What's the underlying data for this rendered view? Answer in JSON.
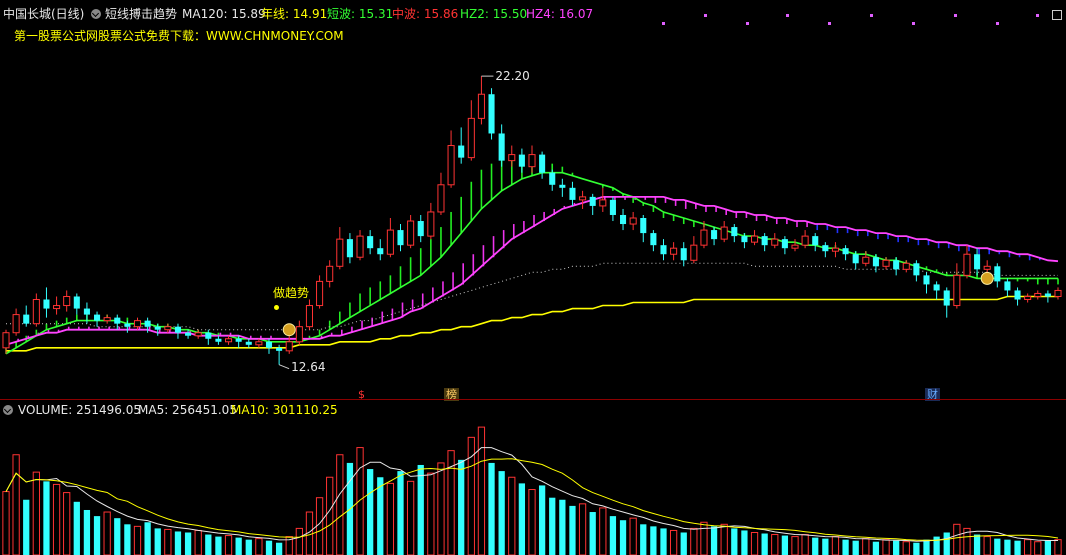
{
  "main_header": {
    "stock_name": "中国长城(日线)",
    "indicator_name": "短线搏击趋势",
    "items": [
      {
        "label": "MA120: 15.89",
        "color": "#e8e8e8"
      },
      {
        "label": "年线: 14.91",
        "color": "#ffff00"
      },
      {
        "label": "短波: 15.31",
        "color": "#33ff33"
      },
      {
        "label": "中波: 15.86",
        "color": "#ff3333"
      },
      {
        "label": "HZ2: 15.50",
        "color": "#33ff33"
      },
      {
        "label": "HZ4: 16.07",
        "color": "#ff44ff"
      }
    ],
    "promo": "第一股票公式网股票公式免费下载：WWW.CHNMONEY.COM"
  },
  "chart_labels": {
    "high": "22.20",
    "low": "12.64",
    "signal": "做趋势",
    "markers": [
      {
        "text": "$",
        "color": "#ff3333"
      },
      {
        "text": "榜",
        "color": "#ffcc66"
      },
      {
        "text": "财",
        "color": "#66aaff"
      }
    ]
  },
  "volume_header": {
    "items": [
      {
        "label": "VOLUME: 251496.05",
        "color": "#e8e8e8"
      },
      {
        "label": "MA5: 256451.05",
        "color": "#e8e8e8"
      },
      {
        "label": "MA10: 301110.25",
        "color": "#ffff00"
      }
    ]
  },
  "chart_data": {
    "type": "candlestick",
    "ylim": [
      12.2,
      22.8
    ],
    "candles": [
      [
        13.2,
        13.7,
        13.0,
        13.8
      ],
      [
        13.7,
        14.3,
        13.6,
        14.5
      ],
      [
        14.3,
        14.0,
        13.9,
        14.6
      ],
      [
        14.0,
        14.8,
        13.9,
        15.0
      ],
      [
        14.8,
        14.5,
        14.2,
        15.2
      ],
      [
        14.5,
        14.6,
        14.3,
        14.9
      ],
      [
        14.6,
        14.9,
        14.4,
        15.1
      ],
      [
        14.9,
        14.5,
        14.3,
        15.0
      ],
      [
        14.5,
        14.3,
        14.0,
        14.7
      ],
      [
        14.3,
        14.1,
        13.9,
        14.4
      ],
      [
        14.1,
        14.2,
        14.0,
        14.3
      ],
      [
        14.2,
        14.0,
        13.8,
        14.3
      ],
      [
        14.0,
        13.9,
        13.7,
        14.1
      ],
      [
        13.9,
        14.1,
        13.8,
        14.2
      ],
      [
        14.1,
        13.9,
        13.7,
        14.2
      ],
      [
        13.9,
        13.8,
        13.6,
        14.0
      ],
      [
        13.8,
        13.9,
        13.7,
        14.0
      ],
      [
        13.9,
        13.7,
        13.5,
        14.0
      ],
      [
        13.7,
        13.6,
        13.5,
        13.8
      ],
      [
        13.6,
        13.7,
        13.5,
        13.8
      ],
      [
        13.7,
        13.5,
        13.3,
        13.8
      ],
      [
        13.5,
        13.4,
        13.3,
        13.6
      ],
      [
        13.4,
        13.5,
        13.3,
        13.6
      ],
      [
        13.5,
        13.4,
        13.2,
        13.6
      ],
      [
        13.4,
        13.3,
        13.2,
        13.5
      ],
      [
        13.3,
        13.4,
        13.2,
        13.5
      ],
      [
        13.4,
        13.2,
        13.0,
        13.5
      ],
      [
        13.2,
        13.1,
        12.64,
        13.3
      ],
      [
        13.1,
        13.4,
        13.0,
        13.6
      ],
      [
        13.4,
        13.9,
        13.3,
        14.1
      ],
      [
        13.9,
        14.6,
        13.8,
        14.8
      ],
      [
        14.6,
        15.4,
        14.5,
        15.6
      ],
      [
        15.4,
        15.9,
        15.2,
        16.1
      ],
      [
        15.9,
        16.8,
        15.8,
        17.2
      ],
      [
        16.8,
        16.2,
        16.0,
        17.0
      ],
      [
        16.2,
        16.9,
        16.1,
        17.1
      ],
      [
        16.9,
        16.5,
        16.3,
        17.1
      ],
      [
        16.5,
        16.3,
        16.1,
        16.8
      ],
      [
        16.3,
        17.1,
        16.2,
        17.5
      ],
      [
        17.1,
        16.6,
        16.4,
        17.3
      ],
      [
        16.6,
        17.4,
        16.5,
        17.6
      ],
      [
        17.4,
        16.9,
        16.7,
        17.6
      ],
      [
        16.9,
        17.7,
        16.8,
        18.0
      ],
      [
        17.7,
        18.6,
        17.6,
        19.0
      ],
      [
        18.6,
        19.9,
        18.5,
        20.4
      ],
      [
        19.9,
        19.5,
        19.3,
        20.5
      ],
      [
        19.5,
        20.8,
        19.4,
        21.4
      ],
      [
        20.8,
        21.6,
        20.6,
        22.2
      ],
      [
        21.6,
        20.3,
        20.1,
        21.8
      ],
      [
        20.3,
        19.4,
        19.2,
        20.6
      ],
      [
        19.4,
        19.6,
        19.2,
        19.9
      ],
      [
        19.6,
        19.2,
        19.0,
        19.8
      ],
      [
        19.2,
        19.6,
        19.0,
        19.9
      ],
      [
        19.6,
        19.0,
        18.8,
        19.7
      ],
      [
        19.0,
        18.6,
        18.4,
        19.1
      ],
      [
        18.6,
        18.5,
        18.2,
        18.8
      ],
      [
        18.5,
        18.1,
        17.9,
        18.7
      ],
      [
        18.1,
        18.2,
        17.8,
        18.4
      ],
      [
        18.2,
        17.9,
        17.6,
        18.3
      ],
      [
        17.9,
        18.1,
        17.7,
        18.5
      ],
      [
        18.1,
        17.6,
        17.4,
        18.2
      ],
      [
        17.6,
        17.3,
        17.1,
        17.8
      ],
      [
        17.3,
        17.5,
        17.1,
        17.7
      ],
      [
        17.5,
        17.0,
        16.7,
        17.6
      ],
      [
        17.0,
        16.6,
        16.4,
        17.1
      ],
      [
        16.6,
        16.3,
        16.1,
        16.8
      ],
      [
        16.3,
        16.5,
        16.1,
        16.7
      ],
      [
        16.5,
        16.1,
        15.9,
        16.7
      ],
      [
        16.1,
        16.6,
        16.0,
        16.9
      ],
      [
        16.6,
        17.1,
        16.5,
        17.4
      ],
      [
        17.1,
        16.8,
        16.6,
        17.2
      ],
      [
        16.8,
        17.2,
        16.7,
        17.4
      ],
      [
        17.2,
        16.9,
        16.7,
        17.3
      ],
      [
        16.9,
        16.7,
        16.5,
        17.0
      ],
      [
        16.7,
        16.9,
        16.6,
        17.1
      ],
      [
        16.9,
        16.6,
        16.4,
        17.0
      ],
      [
        16.6,
        16.8,
        16.5,
        17.0
      ],
      [
        16.8,
        16.5,
        16.3,
        16.9
      ],
      [
        16.5,
        16.6,
        16.4,
        16.8
      ],
      [
        16.6,
        16.9,
        16.5,
        17.1
      ],
      [
        16.9,
        16.6,
        16.4,
        17.0
      ],
      [
        16.6,
        16.4,
        16.2,
        16.7
      ],
      [
        16.4,
        16.5,
        16.2,
        16.7
      ],
      [
        16.5,
        16.3,
        16.1,
        16.6
      ],
      [
        16.3,
        16.0,
        15.8,
        16.4
      ],
      [
        16.0,
        16.2,
        15.9,
        16.4
      ],
      [
        16.2,
        15.9,
        15.7,
        16.3
      ],
      [
        15.9,
        16.1,
        15.8,
        16.2
      ],
      [
        16.1,
        15.8,
        15.6,
        16.2
      ],
      [
        15.8,
        16.0,
        15.7,
        16.1
      ],
      [
        16.0,
        15.6,
        15.4,
        16.1
      ],
      [
        15.6,
        15.3,
        15.0,
        15.7
      ],
      [
        15.3,
        15.1,
        14.8,
        15.4
      ],
      [
        15.1,
        14.6,
        14.2,
        15.2
      ],
      [
        14.6,
        15.6,
        14.5,
        16.0
      ],
      [
        15.6,
        16.3,
        15.5,
        16.6
      ],
      [
        16.3,
        15.8,
        15.6,
        16.5
      ],
      [
        15.8,
        15.9,
        15.6,
        16.1
      ],
      [
        15.9,
        15.4,
        15.2,
        16.0
      ],
      [
        15.4,
        15.1,
        14.9,
        15.5
      ],
      [
        15.1,
        14.8,
        14.6,
        15.2
      ],
      [
        14.8,
        14.9,
        14.7,
        15.0
      ],
      [
        14.9,
        15.0,
        14.8,
        15.1
      ],
      [
        15.0,
        14.9,
        14.7,
        15.1
      ],
      [
        14.9,
        15.1,
        14.8,
        15.2
      ]
    ],
    "ma120": [
      14.0,
      14.0,
      14.0,
      14.0,
      14.0,
      14.0,
      14.0,
      14.0,
      14.0,
      13.9,
      13.9,
      13.9,
      13.9,
      13.9,
      13.9,
      13.9,
      13.9,
      13.9,
      13.9,
      13.8,
      13.8,
      13.8,
      13.8,
      13.8,
      13.8,
      13.8,
      13.8,
      13.8,
      13.8,
      13.8,
      13.8,
      13.8,
      13.9,
      13.9,
      14.0,
      14.1,
      14.1,
      14.2,
      14.3,
      14.4,
      14.5,
      14.6,
      14.7,
      14.8,
      14.9,
      15.0,
      15.1,
      15.2,
      15.3,
      15.4,
      15.5,
      15.6,
      15.7,
      15.7,
      15.8,
      15.8,
      15.9,
      15.9,
      15.9,
      16.0,
      16.0,
      16.0,
      16.0,
      16.0,
      16.0,
      16.0,
      16.0,
      16.0,
      16.0,
      16.0,
      16.0,
      16.0,
      16.0,
      16.0,
      15.9,
      15.9,
      15.9,
      15.9,
      15.9,
      15.9,
      15.9,
      15.9,
      15.9,
      15.8,
      15.8,
      15.8,
      15.8,
      15.8,
      15.8,
      15.8,
      15.8,
      15.7,
      15.7,
      15.7,
      15.7,
      15.7,
      15.7,
      15.7,
      15.6,
      15.6,
      15.6,
      15.6,
      15.6,
      15.6,
      15.6
    ],
    "yearline": [
      13.1,
      13.1,
      13.1,
      13.2,
      13.2,
      13.2,
      13.2,
      13.2,
      13.2,
      13.2,
      13.2,
      13.2,
      13.2,
      13.2,
      13.2,
      13.2,
      13.2,
      13.2,
      13.2,
      13.2,
      13.2,
      13.2,
      13.2,
      13.2,
      13.2,
      13.2,
      13.2,
      13.2,
      13.2,
      13.3,
      13.3,
      13.3,
      13.3,
      13.4,
      13.4,
      13.4,
      13.4,
      13.5,
      13.5,
      13.6,
      13.6,
      13.7,
      13.7,
      13.8,
      13.8,
      13.9,
      13.9,
      14.0,
      14.1,
      14.1,
      14.2,
      14.2,
      14.3,
      14.3,
      14.4,
      14.4,
      14.5,
      14.5,
      14.5,
      14.6,
      14.6,
      14.6,
      14.7,
      14.7,
      14.7,
      14.7,
      14.7,
      14.7,
      14.8,
      14.8,
      14.8,
      14.8,
      14.8,
      14.8,
      14.8,
      14.8,
      14.8,
      14.8,
      14.8,
      14.8,
      14.8,
      14.8,
      14.8,
      14.8,
      14.8,
      14.8,
      14.8,
      14.8,
      14.8,
      14.8,
      14.8,
      14.8,
      14.8,
      14.8,
      14.8,
      14.8,
      14.8,
      14.8,
      14.8,
      14.9,
      14.9,
      14.9,
      14.9,
      14.9,
      14.9
    ],
    "short_wave": [
      13.2,
      13.4,
      13.6,
      13.8,
      14.0,
      14.1,
      14.2,
      14.3,
      14.3,
      14.3,
      14.3,
      14.2,
      14.2,
      14.1,
      14.1,
      14.0,
      14.0,
      13.9,
      13.8,
      13.8,
      13.7,
      13.7,
      13.6,
      13.6,
      13.5,
      13.5,
      13.4,
      13.4,
      13.4,
      13.5,
      13.6,
      13.8,
      14.1,
      14.4,
      14.7,
      15.0,
      15.2,
      15.4,
      15.6,
      15.9,
      16.2,
      16.5,
      16.8,
      17.2,
      17.7,
      18.2,
      18.7,
      19.1,
      19.3,
      19.4,
      19.5,
      19.5,
      19.5,
      19.4,
      19.3,
      19.2,
      19.0,
      18.8,
      18.7,
      18.5,
      18.4,
      18.2,
      18.0,
      17.9,
      17.7,
      17.5,
      17.4,
      17.3,
      17.2,
      17.2,
      17.1,
      17.1,
      17.0,
      17.0,
      16.9,
      16.9,
      16.8,
      16.8,
      16.7,
      16.7,
      16.7,
      16.6,
      16.6,
      16.5,
      16.4,
      16.4,
      16.3,
      16.2,
      16.2,
      16.1,
      16.0,
      15.9,
      15.8,
      15.7,
      15.7,
      15.7,
      15.7,
      15.6,
      15.6,
      15.5,
      15.4,
      15.4,
      15.3,
      15.3,
      15.3
    ],
    "mid_wave": [
      13.4,
      13.5,
      13.6,
      13.7,
      13.8,
      13.8,
      13.9,
      13.9,
      13.9,
      13.9,
      13.9,
      13.9,
      13.9,
      13.9,
      13.9,
      13.8,
      13.8,
      13.8,
      13.8,
      13.7,
      13.7,
      13.7,
      13.7,
      13.6,
      13.6,
      13.6,
      13.6,
      13.5,
      13.5,
      13.5,
      13.5,
      13.6,
      13.7,
      13.8,
      13.9,
      14.1,
      14.2,
      14.4,
      14.5,
      14.7,
      14.8,
      15.0,
      15.2,
      15.4,
      15.7,
      16.0,
      16.3,
      16.6,
      16.9,
      17.1,
      17.3,
      17.4,
      17.6,
      17.7,
      17.8,
      17.9,
      18.0,
      18.0,
      18.1,
      18.1,
      18.1,
      18.1,
      18.1,
      18.1,
      18.0,
      18.0,
      17.9,
      17.8,
      17.8,
      17.7,
      17.7,
      17.6,
      17.5,
      17.5,
      17.4,
      17.4,
      17.3,
      17.3,
      17.2,
      17.2,
      17.1,
      17.1,
      17.0,
      17.0,
      16.9,
      16.9,
      16.8,
      16.8,
      16.7,
      16.7,
      16.6,
      16.6,
      16.5,
      16.5,
      16.4,
      16.4,
      16.3,
      16.3,
      16.3,
      16.2,
      16.2,
      16.1,
      16.1,
      16.1,
      16.07
    ],
    "hz2": [
      13.0,
      13.2,
      13.4,
      13.6,
      13.8,
      13.9,
      14.0,
      14.1,
      14.1,
      14.1,
      14.1,
      14.1,
      14.0,
      14.0,
      14.0,
      13.9,
      13.9,
      13.8,
      13.8,
      13.7,
      13.7,
      13.6,
      13.6,
      13.5,
      13.5,
      13.5,
      13.4,
      13.4,
      13.4,
      13.4,
      13.5,
      13.6,
      13.8,
      14.0,
      14.2,
      14.4,
      14.6,
      14.8,
      15.0,
      15.2,
      15.4,
      15.6,
      15.9,
      16.2,
      16.6,
      17.0,
      17.4,
      17.8,
      18.1,
      18.4,
      18.6,
      18.8,
      18.9,
      19.0,
      19.0,
      19.0,
      18.9,
      18.8,
      18.7,
      18.6,
      18.5,
      18.3,
      18.2,
      18.0,
      17.9,
      17.7,
      17.6,
      17.5,
      17.4,
      17.3,
      17.2,
      17.1,
      17.0,
      16.9,
      16.9,
      16.8,
      16.8,
      16.7,
      16.7,
      16.6,
      16.6,
      16.5,
      16.5,
      16.4,
      16.3,
      16.3,
      16.2,
      16.1,
      16.1,
      16.0,
      15.9,
      15.8,
      15.7,
      15.6,
      15.6,
      15.6,
      15.5,
      15.5,
      15.5,
      15.5,
      15.5,
      15.5,
      15.5,
      15.5,
      15.5
    ],
    "hz4": [
      13.3,
      13.4,
      13.5,
      13.6,
      13.7,
      13.7,
      13.8,
      13.8,
      13.8,
      13.8,
      13.8,
      13.8,
      13.8,
      13.8,
      13.8,
      13.7,
      13.7,
      13.7,
      13.7,
      13.6,
      13.6,
      13.6,
      13.6,
      13.6,
      13.5,
      13.5,
      13.5,
      13.5,
      13.5,
      13.5,
      13.5,
      13.5,
      13.6,
      13.6,
      13.7,
      13.8,
      13.9,
      14.0,
      14.1,
      14.2,
      14.4,
      14.5,
      14.7,
      14.9,
      15.1,
      15.3,
      15.6,
      15.9,
      16.2,
      16.5,
      16.8,
      17.0,
      17.2,
      17.4,
      17.6,
      17.8,
      17.9,
      18.0,
      18.1,
      18.2,
      18.2,
      18.2,
      18.2,
      18.2,
      18.2,
      18.2,
      18.1,
      18.1,
      18.0,
      17.9,
      17.9,
      17.8,
      17.7,
      17.7,
      17.6,
      17.6,
      17.5,
      17.5,
      17.4,
      17.4,
      17.3,
      17.3,
      17.2,
      17.2,
      17.1,
      17.1,
      17.0,
      17.0,
      16.9,
      16.9,
      16.8,
      16.8,
      16.7,
      16.7,
      16.6,
      16.6,
      16.5,
      16.5,
      16.4,
      16.4,
      16.3,
      16.3,
      16.2,
      16.1,
      16.07
    ],
    "volume": [
      620,
      980,
      540,
      810,
      720,
      690,
      610,
      520,
      440,
      380,
      420,
      360,
      300,
      280,
      320,
      260,
      250,
      230,
      220,
      240,
      200,
      180,
      190,
      170,
      150,
      160,
      140,
      120,
      180,
      260,
      420,
      560,
      760,
      980,
      900,
      1050,
      840,
      760,
      700,
      820,
      720,
      880,
      800,
      900,
      1020,
      930,
      1150,
      1250,
      900,
      820,
      760,
      700,
      640,
      680,
      560,
      540,
      480,
      500,
      420,
      460,
      380,
      340,
      360,
      300,
      280,
      260,
      240,
      220,
      260,
      320,
      280,
      300,
      260,
      240,
      220,
      210,
      200,
      190,
      180,
      200,
      170,
      160,
      180,
      150,
      140,
      160,
      130,
      150,
      140,
      130,
      120,
      150,
      180,
      220,
      300,
      260,
      200,
      180,
      160,
      150,
      140,
      150,
      130,
      140,
      150
    ],
    "volume_ylim": [
      0,
      1300
    ]
  }
}
